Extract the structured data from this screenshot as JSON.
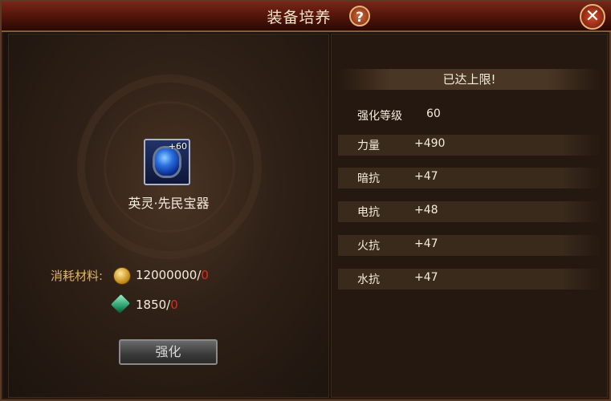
{
  "window": {
    "title": "装备培养",
    "help_label": "?",
    "close_label": "✕",
    "icons": {
      "help": "question-icon",
      "close": "close-icon"
    }
  },
  "item": {
    "name": "英灵·先民宝器",
    "level_badge": "+60",
    "icon": "blue-gem-amulet-icon"
  },
  "cost": {
    "label": "消耗材料:",
    "gold_amount": "12000000/",
    "gold_owned": "0",
    "crystal_amount": "1850/",
    "crystal_owned": "0",
    "icons": {
      "gold": "gold-coin-icon",
      "crystal": "green-crystal-icon"
    }
  },
  "action": {
    "label": "强化"
  },
  "stats_panel": {
    "banner": "已达上限!",
    "rows": [
      {
        "label": "强化等级",
        "value": "60"
      },
      {
        "label": "力量",
        "value": "+490"
      },
      {
        "label": "暗抗",
        "value": "+47"
      },
      {
        "label": "电抗",
        "value": "+48"
      },
      {
        "label": "火抗",
        "value": "+47"
      },
      {
        "label": "水抗",
        "value": "+47"
      }
    ]
  },
  "colors": {
    "title_bar": "#7a2518",
    "label_gold": "#e0b468",
    "shortage_red": "#e02a1a",
    "text": "#f4ecdc"
  }
}
